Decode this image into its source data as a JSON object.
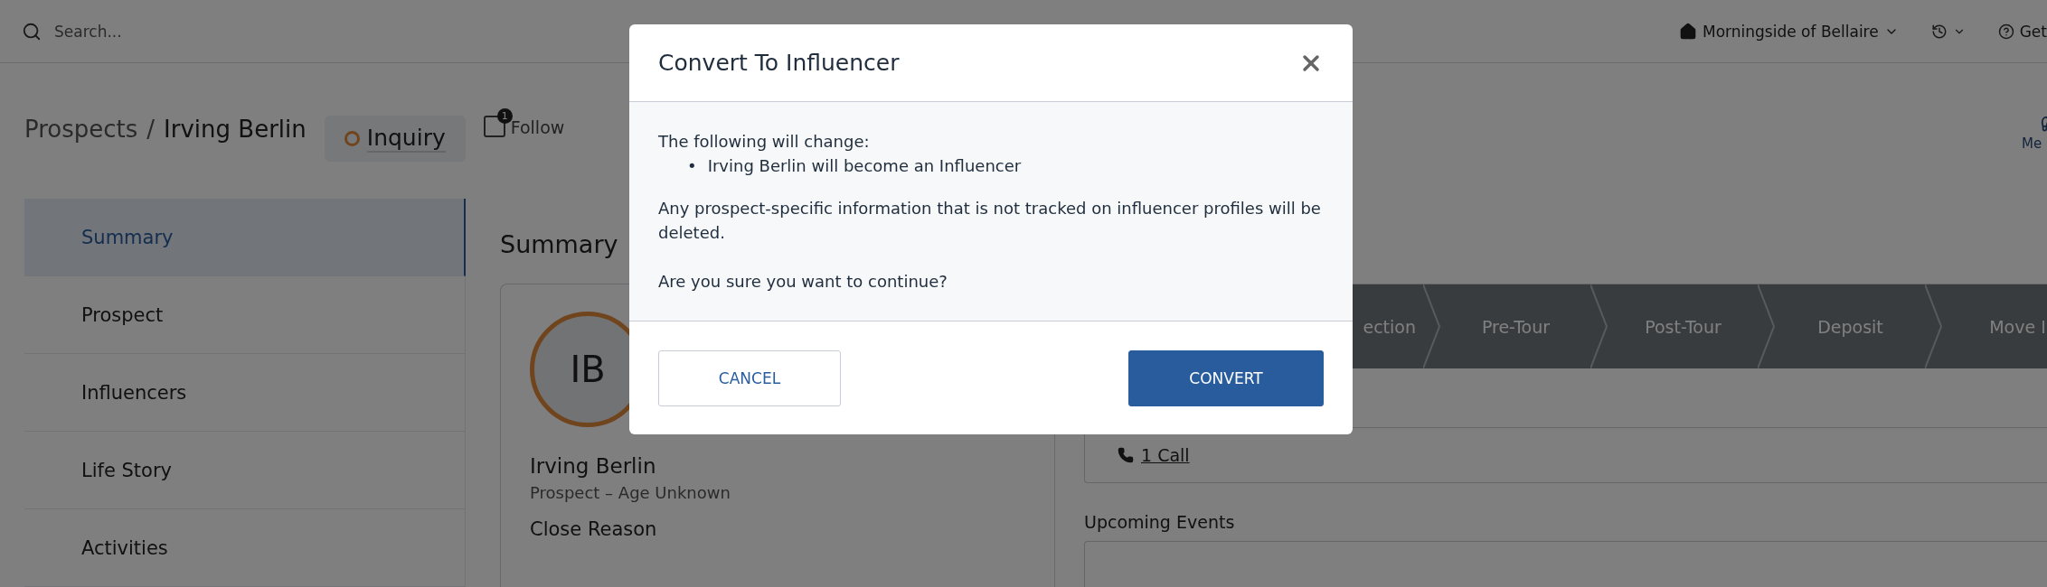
{
  "topbar": {
    "search": {
      "placeholder": "Search..."
    },
    "community": "Morningside of Bellaire",
    "help": "Get"
  },
  "header": {
    "breadcrumb_parent": "Prospects",
    "breadcrumb_separator": "/",
    "breadcrumb_current": "Irving Berlin",
    "status": "Inquiry",
    "follow": {
      "label": "Follow",
      "count": "1"
    },
    "action": "Me"
  },
  "sidebar": {
    "items": [
      {
        "label": "Summary",
        "selected": true
      },
      {
        "label": "Prospect",
        "selected": false
      },
      {
        "label": "Influencers",
        "selected": false
      },
      {
        "label": "Life Story",
        "selected": false
      },
      {
        "label": "Activities",
        "selected": false
      }
    ]
  },
  "summary": {
    "title": "Summary",
    "profile": {
      "initials": "IB",
      "name": "Irving Berlin",
      "subtitle": "Prospect – Age Unknown",
      "field_label": "Close Reason"
    },
    "stages": [
      "ection",
      "Pre-Tour",
      "Post-Tour",
      "Deposit",
      "Move I"
    ],
    "activity_link": "1 Call",
    "upcoming_label": "Upcoming Events"
  },
  "dialog": {
    "title": "Convert To Influencer",
    "intro": "The following will change:",
    "changes": [
      {
        "marker": "•",
        "text": "Irving Berlin will become an Influencer"
      }
    ],
    "warning": "Any prospect-specific information that is not tracked on influencer profiles will be deleted.",
    "question": "Are you sure you want to continue?",
    "buttons": [
      {
        "label": "CANCEL",
        "kind": "secondary"
      },
      {
        "label": "CONVERT",
        "kind": "primary"
      }
    ]
  }
}
